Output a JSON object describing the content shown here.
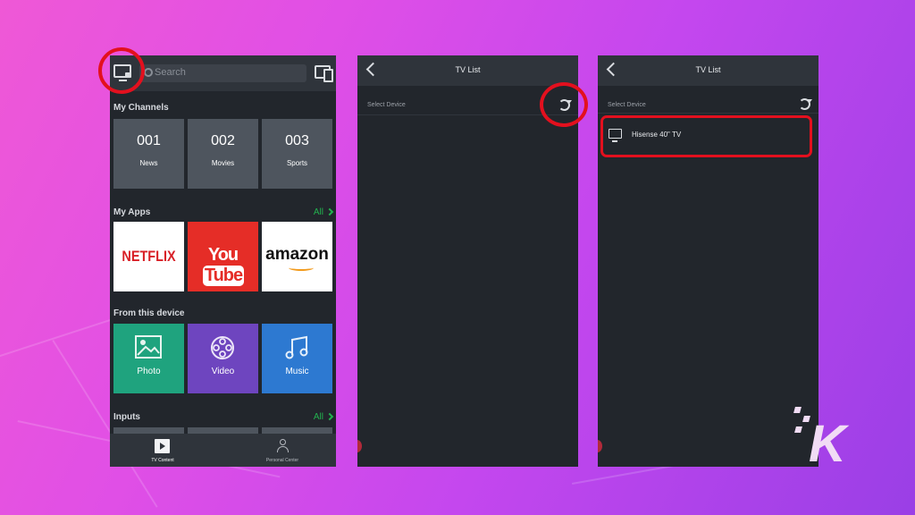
{
  "brand_colors": {
    "accent_red": "#e3101e",
    "all_link_green": "#22b34f",
    "phone_bg": "#22262c"
  },
  "screen1": {
    "search_placeholder": "Search",
    "icons": {
      "tv": "tv-remote-icon",
      "device": "devices-icon"
    },
    "sections": {
      "my_channels": "My Channels",
      "my_apps": "My Apps",
      "from_device": "From this device",
      "inputs": "Inputs",
      "all": "All"
    },
    "channels": [
      {
        "num": "001",
        "name": "News"
      },
      {
        "num": "002",
        "name": "Movies"
      },
      {
        "num": "003",
        "name": "Sports"
      }
    ],
    "apps": {
      "netflix": "NETFLIX",
      "youtube_a": "You",
      "youtube_b": "Tube",
      "amazon": "amazon"
    },
    "device_items": [
      {
        "label": "Photo",
        "icon": "photo-icon"
      },
      {
        "label": "Video",
        "icon": "film-reel-icon"
      },
      {
        "label": "Music",
        "icon": "music-note-icon"
      }
    ],
    "tabs": [
      {
        "label": "TV Content",
        "icon": "play-icon"
      },
      {
        "label": "Personal Center",
        "icon": "person-icon"
      }
    ]
  },
  "screen2": {
    "title": "TV List",
    "select_label": "Select Device"
  },
  "screen3": {
    "title": "TV List",
    "select_label": "Select Device",
    "device": "Hisense 40\" TV"
  },
  "watermark": "K"
}
